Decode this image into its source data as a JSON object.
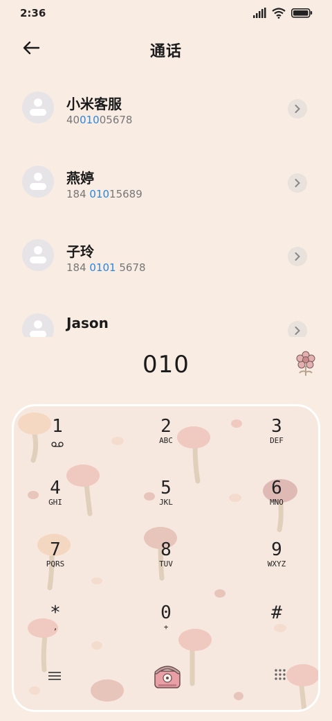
{
  "status": {
    "time": "2:36"
  },
  "header": {
    "title": "通话"
  },
  "contacts": [
    {
      "name": "小米客服",
      "number_pre": "40",
      "number_hl": "010",
      "number_post": "05678"
    },
    {
      "name": "燕婷",
      "number_pre": "184 ",
      "number_hl": "010",
      "number_post": "15689"
    },
    {
      "name": "子玲",
      "number_pre": "184 ",
      "number_hl": "0101",
      "number_post": " 5678"
    },
    {
      "name": "Jason",
      "number_pre": "",
      "number_hl": "",
      "number_post": ""
    }
  ],
  "dialed": "010",
  "keypad": {
    "keys": [
      {
        "digit": "1",
        "letters": ""
      },
      {
        "digit": "2",
        "letters": "ABC"
      },
      {
        "digit": "3",
        "letters": "DEF"
      },
      {
        "digit": "4",
        "letters": "GHI"
      },
      {
        "digit": "5",
        "letters": "JKL"
      },
      {
        "digit": "6",
        "letters": "MNO"
      },
      {
        "digit": "7",
        "letters": "PQRS"
      },
      {
        "digit": "8",
        "letters": "TUV"
      },
      {
        "digit": "9",
        "letters": "WXYZ"
      },
      {
        "digit": "*",
        "letters": ","
      },
      {
        "digit": "0",
        "letters": "+"
      },
      {
        "digit": "#",
        "letters": ""
      }
    ]
  },
  "colors": {
    "background": "#f8ece3",
    "highlight": "#2a86e0",
    "call_button": "#e8a0a6"
  },
  "icons": [
    "signal-icon",
    "wifi-icon",
    "battery-icon",
    "back-arrow-icon",
    "chevron-right-icon",
    "flower-icon",
    "voicemail-icon",
    "menu-icon",
    "call-button-icon",
    "dialpad-icon"
  ]
}
